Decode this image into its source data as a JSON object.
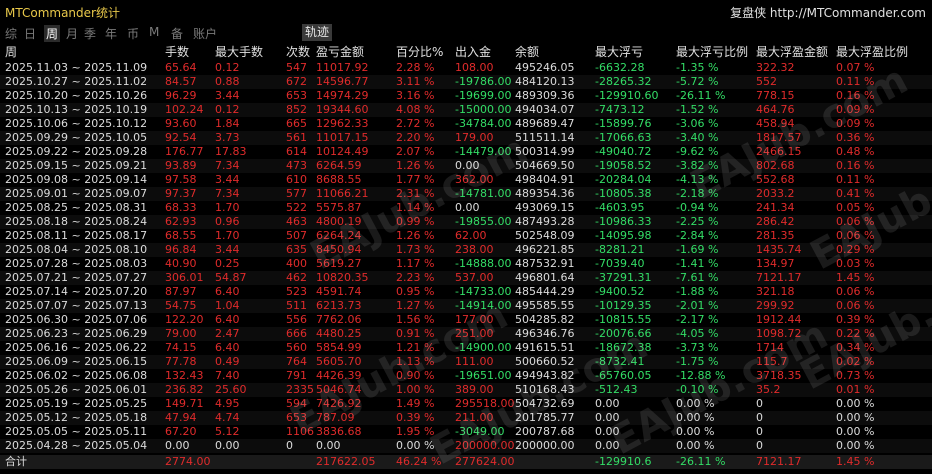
{
  "app": {
    "title": "MTCommander统计",
    "credit": "复盘侠 http://MTCommander.com"
  },
  "tabs": [
    "综",
    "日",
    "周",
    "月",
    "季",
    "年",
    "币",
    "M",
    "备",
    "账户"
  ],
  "active_tab": "周",
  "track_button": "轨迹",
  "watermark": "EAJub.com",
  "columns": [
    "周",
    "手数",
    "最大手数",
    "次数",
    "盈亏金额",
    "百分比%",
    "出入金",
    "余额",
    "最大浮亏",
    "最大浮亏比例",
    "最大浮盈金额",
    "最大浮盈比例"
  ],
  "rows": [
    [
      "2025.11.03 ~ 2025.11.09",
      "65.64",
      "0.12",
      "547",
      "11017.92",
      "2.28 %",
      "108.00",
      "495246.05",
      "-6632.28",
      "-1.35 %",
      "322.32",
      "0.07 %"
    ],
    [
      "2025.10.27 ~ 2025.11.02",
      "84.57",
      "0.88",
      "672",
      "14596.77",
      "3.11 %",
      "-19786.00",
      "484120.13",
      "-28265.32",
      "-5.72 %",
      "552",
      "0.11 %"
    ],
    [
      "2025.10.20 ~ 2025.10.26",
      "96.29",
      "3.44",
      "653",
      "14974.29",
      "3.16 %",
      "-19699.00",
      "489309.36",
      "-129910.60",
      "-26.11 %",
      "778.15",
      "0.16 %"
    ],
    [
      "2025.10.13 ~ 2025.10.19",
      "102.24",
      "0.12",
      "852",
      "19344.60",
      "4.08 %",
      "-15000.00",
      "494034.07",
      "-7473.12",
      "-1.52 %",
      "464.76",
      "0.09 %"
    ],
    [
      "2025.10.06 ~ 2025.10.12",
      "93.60",
      "1.84",
      "665",
      "12962.33",
      "2.72 %",
      "-34784.00",
      "489689.47",
      "-15899.76",
      "-3.06 %",
      "458.94",
      "0.09 %"
    ],
    [
      "2025.09.29 ~ 2025.10.05",
      "92.54",
      "3.73",
      "561",
      "11017.15",
      "2.20 %",
      "179.00",
      "511511.14",
      "-17066.63",
      "-3.40 %",
      "1817.57",
      "0.36 %"
    ],
    [
      "2025.09.22 ~ 2025.09.28",
      "176.77",
      "17.83",
      "614",
      "10124.49",
      "2.07 %",
      "-14479.00",
      "500314.99",
      "-49040.72",
      "-9.62 %",
      "2466.15",
      "0.48 %"
    ],
    [
      "2025.09.15 ~ 2025.09.21",
      "93.89",
      "7.34",
      "473",
      "6264.59",
      "1.26 %",
      "0.00",
      "504669.50",
      "-19058.52",
      "-3.82 %",
      "802.68",
      "0.16 %"
    ],
    [
      "2025.09.08 ~ 2025.09.14",
      "97.58",
      "3.44",
      "610",
      "8688.55",
      "1.77 %",
      "362.00",
      "498404.91",
      "-20284.04",
      "-4.13 %",
      "552.68",
      "0.11 %"
    ],
    [
      "2025.09.01 ~ 2025.09.07",
      "97.37",
      "7.34",
      "577",
      "11066.21",
      "2.31 %",
      "-14781.00",
      "489354.36",
      "-10805.38",
      "-2.18 %",
      "2033.2",
      "0.41 %"
    ],
    [
      "2025.08.25 ~ 2025.08.31",
      "68.33",
      "1.70",
      "522",
      "5575.87",
      "1.14 %",
      "0.00",
      "493069.15",
      "-4603.95",
      "-0.94 %",
      "241.34",
      "0.05 %"
    ],
    [
      "2025.08.18 ~ 2025.08.24",
      "62.93",
      "0.96",
      "463",
      "4800.19",
      "0.99 %",
      "-19855.00",
      "487493.28",
      "-10986.33",
      "-2.25 %",
      "286.42",
      "0.06 %"
    ],
    [
      "2025.08.11 ~ 2025.08.17",
      "68.55",
      "1.70",
      "507",
      "6264.24",
      "1.26 %",
      "62.00",
      "502548.09",
      "-14095.98",
      "-2.84 %",
      "281.35",
      "0.06 %"
    ],
    [
      "2025.08.04 ~ 2025.08.10",
      "96.84",
      "3.44",
      "635",
      "8450.94",
      "1.73 %",
      "238.00",
      "496221.85",
      "-8281.21",
      "-1.69 %",
      "1435.74",
      "0.29 %"
    ],
    [
      "2025.07.28 ~ 2025.08.03",
      "40.90",
      "0.25",
      "400",
      "5619.27",
      "1.17 %",
      "-14888.00",
      "487532.91",
      "-7039.40",
      "-1.41 %",
      "134.97",
      "0.03 %"
    ],
    [
      "2025.07.21 ~ 2025.07.27",
      "306.01",
      "54.87",
      "462",
      "10820.35",
      "2.23 %",
      "537.00",
      "496801.64",
      "-37291.31",
      "-7.61 %",
      "7121.17",
      "1.45 %"
    ],
    [
      "2025.07.14 ~ 2025.07.20",
      "87.97",
      "6.40",
      "523",
      "4591.74",
      "0.95 %",
      "-14733.00",
      "485444.29",
      "-9400.52",
      "-1.88 %",
      "321.18",
      "0.06 %"
    ],
    [
      "2025.07.07 ~ 2025.07.13",
      "54.75",
      "1.04",
      "511",
      "6213.73",
      "1.27 %",
      "-14914.00",
      "495585.55",
      "-10129.35",
      "-2.01 %",
      "299.92",
      "0.06 %"
    ],
    [
      "2025.06.30 ~ 2025.07.06",
      "122.20",
      "6.40",
      "556",
      "7762.06",
      "1.56 %",
      "177.00",
      "504285.82",
      "-10815.55",
      "-2.17 %",
      "1912.44",
      "0.39 %"
    ],
    [
      "2025.06.23 ~ 2025.06.29",
      "79.00",
      "2.47",
      "666",
      "4480.25",
      "0.91 %",
      "251.00",
      "496346.76",
      "-20076.66",
      "-4.05 %",
      "1098.72",
      "0.22 %"
    ],
    [
      "2025.06.16 ~ 2025.06.22",
      "74.15",
      "6.40",
      "560",
      "5854.99",
      "1.21 %",
      "-14900.00",
      "491615.51",
      "-18672.38",
      "-3.73 %",
      "1714",
      "0.34 %"
    ],
    [
      "2025.06.09 ~ 2025.06.15",
      "77.78",
      "0.49",
      "764",
      "5605.70",
      "1.13 %",
      "111.00",
      "500660.52",
      "-8732.41",
      "-1.75 %",
      "115.7",
      "0.02 %"
    ],
    [
      "2025.06.02 ~ 2025.06.08",
      "132.43",
      "7.40",
      "791",
      "4426.39",
      "0.90 %",
      "-19651.00",
      "494943.82",
      "-65760.05",
      "-12.88 %",
      "3718.35",
      "0.73 %"
    ],
    [
      "2025.05.26 ~ 2025.06.01",
      "236.82",
      "25.60",
      "2335",
      "5046.74",
      "1.00 %",
      "389.00",
      "510168.43",
      "-512.43",
      "-0.10 %",
      "35.2",
      "0.01 %"
    ],
    [
      "2025.05.19 ~ 2025.05.25",
      "149.71",
      "4.95",
      "594",
      "7426.92",
      "1.49 %",
      "295518.00",
      "504732.69",
      "0.00",
      "0.00 %",
      "0",
      "0.00 %"
    ],
    [
      "2025.05.12 ~ 2025.05.18",
      "47.94",
      "4.74",
      "653",
      "787.09",
      "0.39 %",
      "211.00",
      "201785.77",
      "0.00",
      "0.00 %",
      "0",
      "0.00 %"
    ],
    [
      "2025.05.05 ~ 2025.05.11",
      "67.20",
      "5.12",
      "1106",
      "3836.68",
      "1.95 %",
      "-3049.00",
      "200787.68",
      "0.00",
      "0.00 %",
      "0",
      "0.00 %"
    ],
    [
      "2025.04.28 ~ 2025.05.04",
      "0.00",
      "0.00",
      "0",
      "0.00",
      "0.00 %",
      "200000.00",
      "200000.00",
      "0.00",
      "0.00 %",
      "0",
      "0.00 %"
    ]
  ],
  "total": [
    "合计",
    "2774.00",
    "",
    "",
    "217622.05",
    "46.24 %",
    "277624.00",
    "",
    "-129910.6",
    "-26.11 %",
    "7121.17",
    "1.45 %"
  ],
  "colors": {
    "positive": "#e02b2b",
    "negative": "#33dd66",
    "neutral": "#dcdcdc",
    "title": "#e8c84a"
  }
}
